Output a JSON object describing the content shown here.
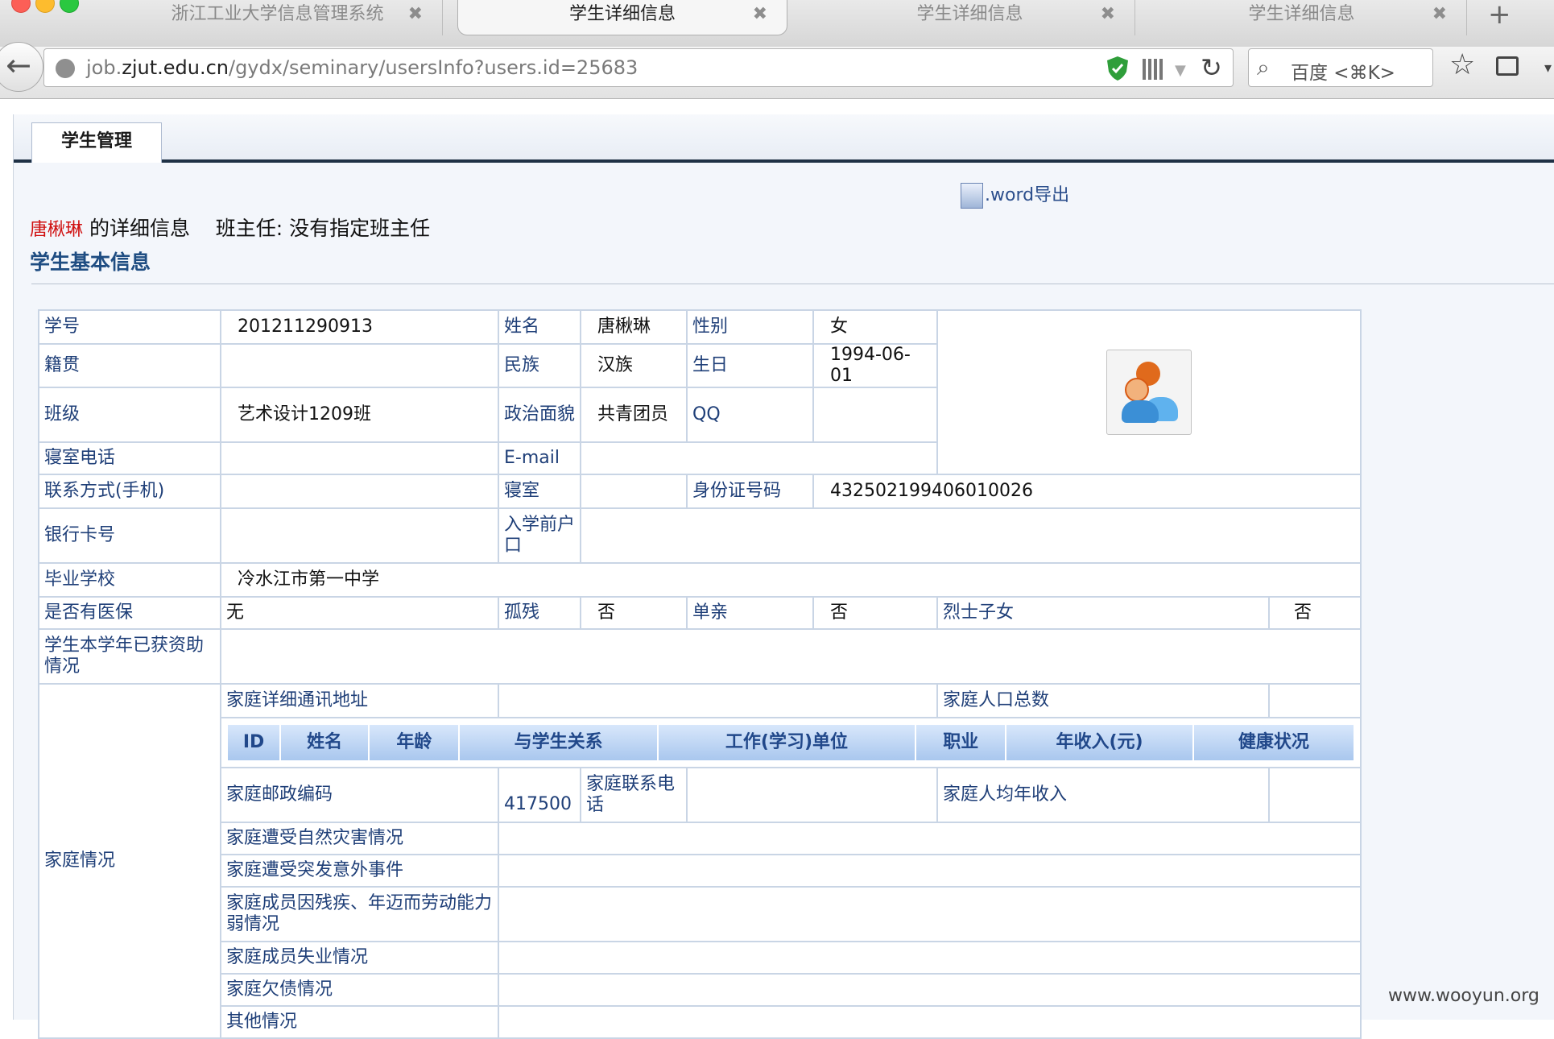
{
  "browser": {
    "tabs": [
      {
        "title": "浙江工业大学信息管理系统",
        "active": false
      },
      {
        "title": "学生详细信息",
        "active": true
      },
      {
        "title": "学生详细信息",
        "active": false
      },
      {
        "title": "学生详细信息",
        "active": false
      }
    ],
    "close_glyph": "✖",
    "new_tab": "+",
    "url_prefix": "job.",
    "url_domain": "zjut.edu.cn",
    "url_path": "/gydx/seminary/usersInfo?users.id=25683",
    "search_placeholder": "百度 <⌘K>"
  },
  "module_tab": "学生管理",
  "word_export": ".word导出",
  "header": {
    "name": "唐楸琳",
    "detail_suffix": " 的详细信息",
    "teacher": "班主任: 没有指定班主任"
  },
  "section_title": "学生基本信息",
  "labels": {
    "student_id": "学号",
    "name": "姓名",
    "gender": "性别",
    "native_place": "籍贯",
    "ethnicity": "民族",
    "birthday": "生日",
    "class": "班级",
    "political": "政治面貌",
    "qq": "QQ",
    "dorm_phone": "寝室电话",
    "email": "E-mail",
    "mobile": "联系方式(手机)",
    "dorm": "寝室",
    "id_card": "身份证号码",
    "bank_card": "银行卡号",
    "hukou": "入学前户口",
    "graduated_school": "毕业学校",
    "medical_insurance": "是否有医保",
    "orphan": "孤残",
    "single_parent": "单亲",
    "martyr_child": "烈士子女",
    "aid_received": "学生本学年已获资助情况",
    "family": "家庭情况",
    "family_address": "家庭详细通讯地址",
    "family_size": "家庭人口总数",
    "family_postcode": "家庭邮政编码",
    "family_phone": "家庭联系电话",
    "family_avg_income": "家庭人均年收入",
    "natural_disaster": "家庭遭受自然灾害情况",
    "accident": "家庭遭受突发意外事件",
    "disability": "家庭成员因残疾、年迈而劳动能力弱情况",
    "unemployment": "家庭成员失业情况",
    "debt": "家庭欠债情况",
    "other": "其他情况"
  },
  "values": {
    "student_id": "201211290913",
    "name": "唐楸琳",
    "gender": "女",
    "ethnicity": "汉族",
    "birthday": "1994-06-01",
    "class": "艺术设计1209班",
    "political": "共青团员",
    "id_card": "432502199406010026",
    "graduated_school": "冷水江市第一中学",
    "medical_insurance": "无",
    "orphan": "否",
    "single_parent": "否",
    "martyr_child": "否",
    "family_postcode": "417500"
  },
  "family_members_headers": [
    "ID",
    "姓名",
    "年龄",
    "与学生关系",
    "工作(学习)单位",
    "职业",
    "年收入(元)",
    "健康状况"
  ],
  "watermark": "www.wooyun.org",
  "colors": {
    "label": "#1f3f78",
    "name_highlight": "#d01010",
    "section_title": "#1f4d82",
    "table_header_bg": "#a9c7ee"
  }
}
